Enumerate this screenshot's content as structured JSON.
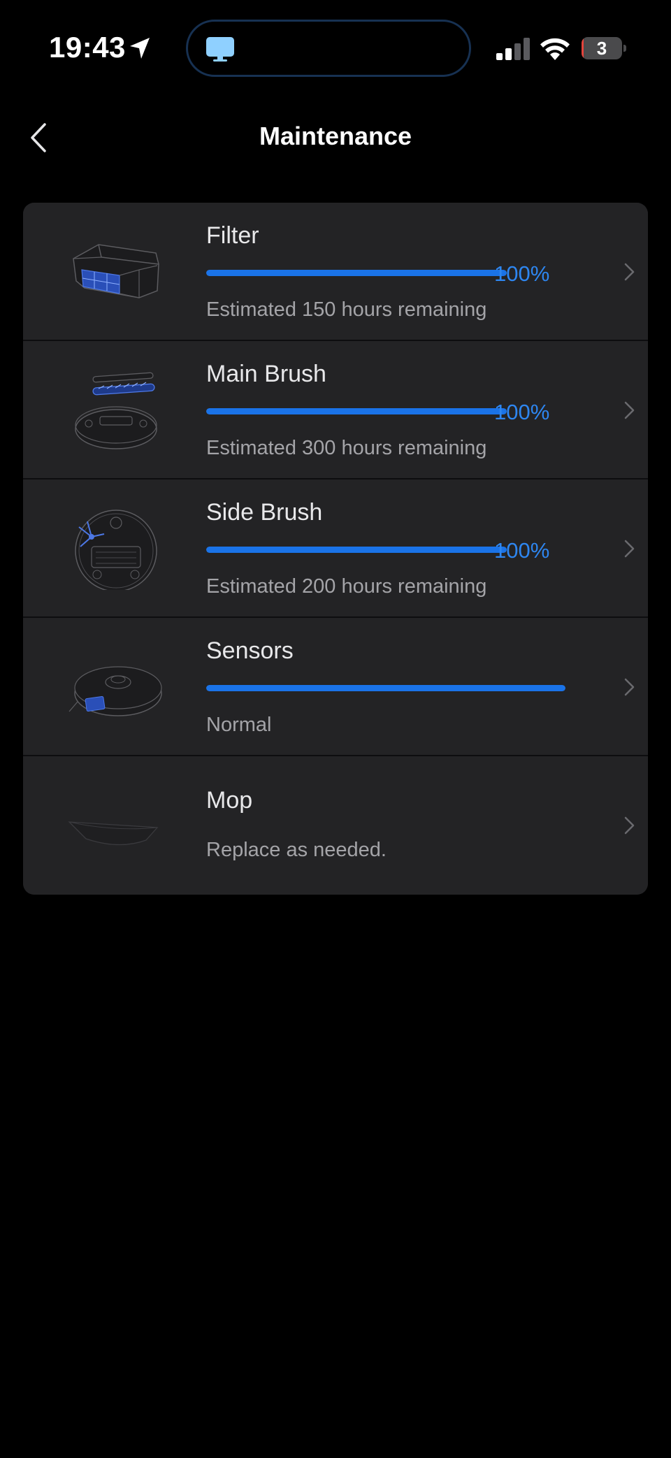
{
  "status_bar": {
    "time": "19:43",
    "battery_level": "3",
    "battery_fraction": 0.03
  },
  "header": {
    "title": "Maintenance"
  },
  "colors": {
    "accent": "#1a73e8",
    "accent_text": "#2e86f0",
    "card_background": "#232325",
    "page_background": "#000000",
    "subtitle_text": "#a4a4a8",
    "battery_low": "#e5443c"
  },
  "items": [
    {
      "title": "Filter",
      "percent": "100%",
      "progress": 1.0,
      "subtitle": "Estimated 150 hours remaining",
      "image": "filter-image"
    },
    {
      "title": "Main Brush",
      "percent": "100%",
      "progress": 1.0,
      "subtitle": "Estimated 300 hours remaining",
      "image": "main-brush-image"
    },
    {
      "title": "Side Brush",
      "percent": "100%",
      "progress": 1.0,
      "subtitle": "Estimated 200 hours remaining",
      "image": "side-brush-image"
    },
    {
      "title": "Sensors",
      "progress": 1.0,
      "subtitle": "Normal",
      "image": "sensors-image"
    },
    {
      "title": "Mop",
      "subtitle": "Replace as needed.",
      "image": "mop-image"
    }
  ]
}
